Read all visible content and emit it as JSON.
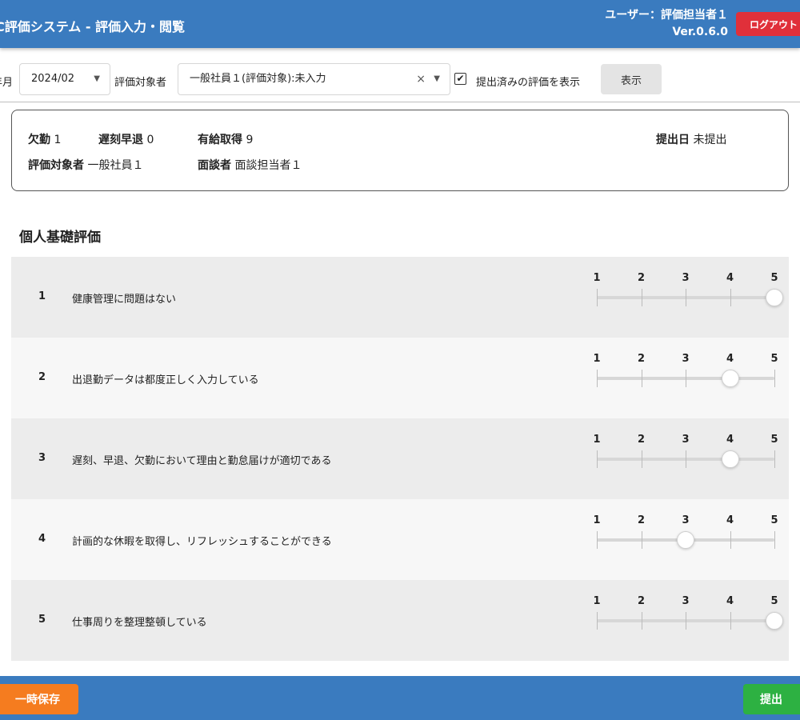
{
  "header": {
    "title": "C評価システム - 評価入力・閲覧",
    "user": "ユーザー：評価担当者１",
    "version": "Ver.0.6.0",
    "logout_label": "ログアウト"
  },
  "filters": {
    "yearmonth_label": "年月",
    "month_value": "2024/02",
    "target_label": "評価対象者",
    "target_value": "一般社員１(評価対象):未入力",
    "show_submitted_checked": true,
    "show_submitted_label": "提出済みの評価を表示",
    "show_button": "表示"
  },
  "info": {
    "absence_label": "欠勤",
    "absence_value": "1",
    "late_label": "遅刻早退",
    "late_value": "0",
    "paid_leave_label": "有給取得",
    "paid_leave_value": "9",
    "submit_date_label": "提出日",
    "submit_date_value": "未提出",
    "evaluatee_label": "評価対象者",
    "evaluatee_value": "一般社員１",
    "interviewer_label": "面談者",
    "interviewer_value": "面談担当者１"
  },
  "section": {
    "title": "個人基礎評価",
    "scale": [
      "1",
      "2",
      "3",
      "4",
      "5"
    ],
    "items": [
      {
        "num": "1",
        "text": "健康管理に問題はない",
        "score": 5
      },
      {
        "num": "2",
        "text": "出退勤データは都度正しく入力している",
        "score": 4
      },
      {
        "num": "3",
        "text": "遅刻、早退、欠勤において理由と勤怠届けが適切である",
        "score": 4
      },
      {
        "num": "4",
        "text": "計画的な休暇を取得し、リフレッシュすることができる",
        "score": 3
      },
      {
        "num": "5",
        "text": "仕事周りを整理整頓している",
        "score": 5
      }
    ]
  },
  "footer": {
    "save_label": "一時保存",
    "submit_label": "提出"
  },
  "icons": {
    "caret": "▼",
    "clear": "×",
    "check": "✔"
  }
}
